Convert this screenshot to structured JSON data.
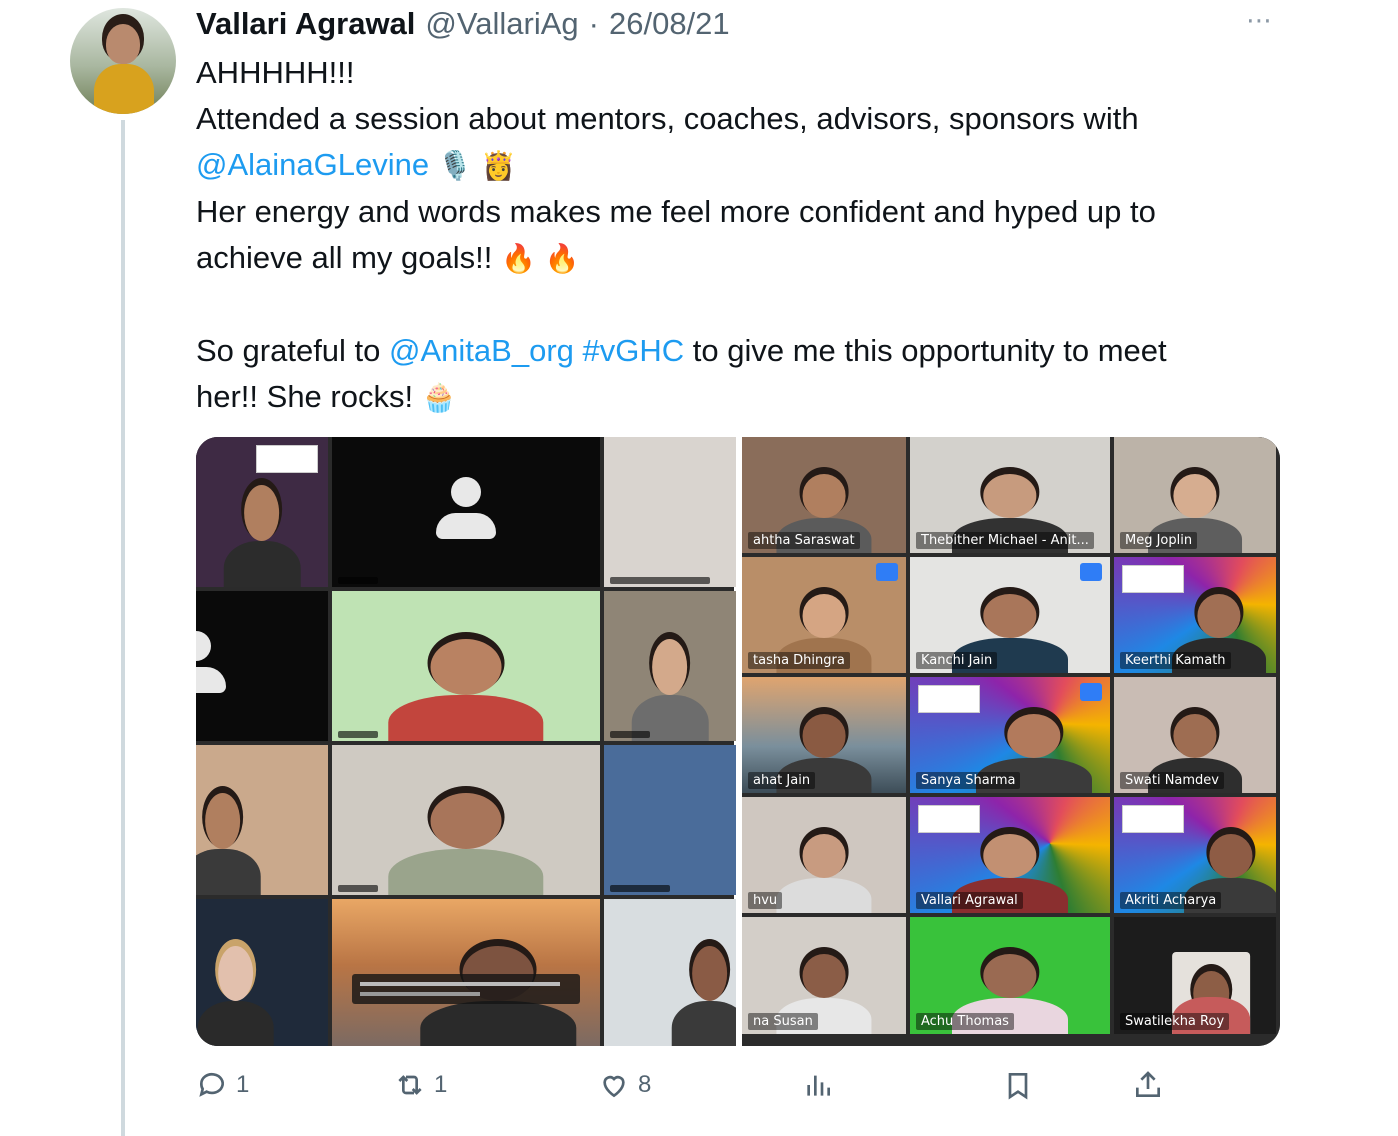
{
  "author": {
    "name": "Vallari Agrawal",
    "handle": "@VallariAg",
    "separator": "·",
    "date": "26/08/21"
  },
  "more_icon": "⋯",
  "tweet": {
    "line1": "AHHHHH!!!",
    "line2_prefix": "Attended a session about mentors, coaches, advisors, sponsors with",
    "mention1": "@AlainaGLevine",
    "emoji_mic": "🎙️",
    "emoji_princess": "👸",
    "line3": "Her energy and words makes me feel more confident and hyped up to",
    "line4_prefix": "achieve all my goals!!",
    "emoji_fire": "🔥",
    "line5_prefix": "So grateful to",
    "mention2": "@AnitaB_org",
    "hashtag": "#vGHC",
    "line5_suffix": "to give me this opportunity to meet",
    "line6_prefix": "her!! She rocks!",
    "emoji_cupcake": "🧁"
  },
  "media": {
    "right_labels": [
      "ahtha Saraswat",
      "Thebither Michael - Anit...",
      "Meg Joplin",
      "tasha Dhingra",
      "Kanchi Jain",
      "Keerthi Kamath",
      "ahat Jain",
      "Sanya Sharma",
      "Swati Namdev",
      "hvu",
      "Vallari Agrawal",
      "Akriti Acharya",
      "na Susan",
      "Achu Thomas",
      "Swatilekha Roy"
    ]
  },
  "actions": {
    "reply_count": "1",
    "retweet_count": "1",
    "like_count": "8",
    "colors": {
      "icon": "#536471",
      "link": "#1d9bf0"
    }
  }
}
